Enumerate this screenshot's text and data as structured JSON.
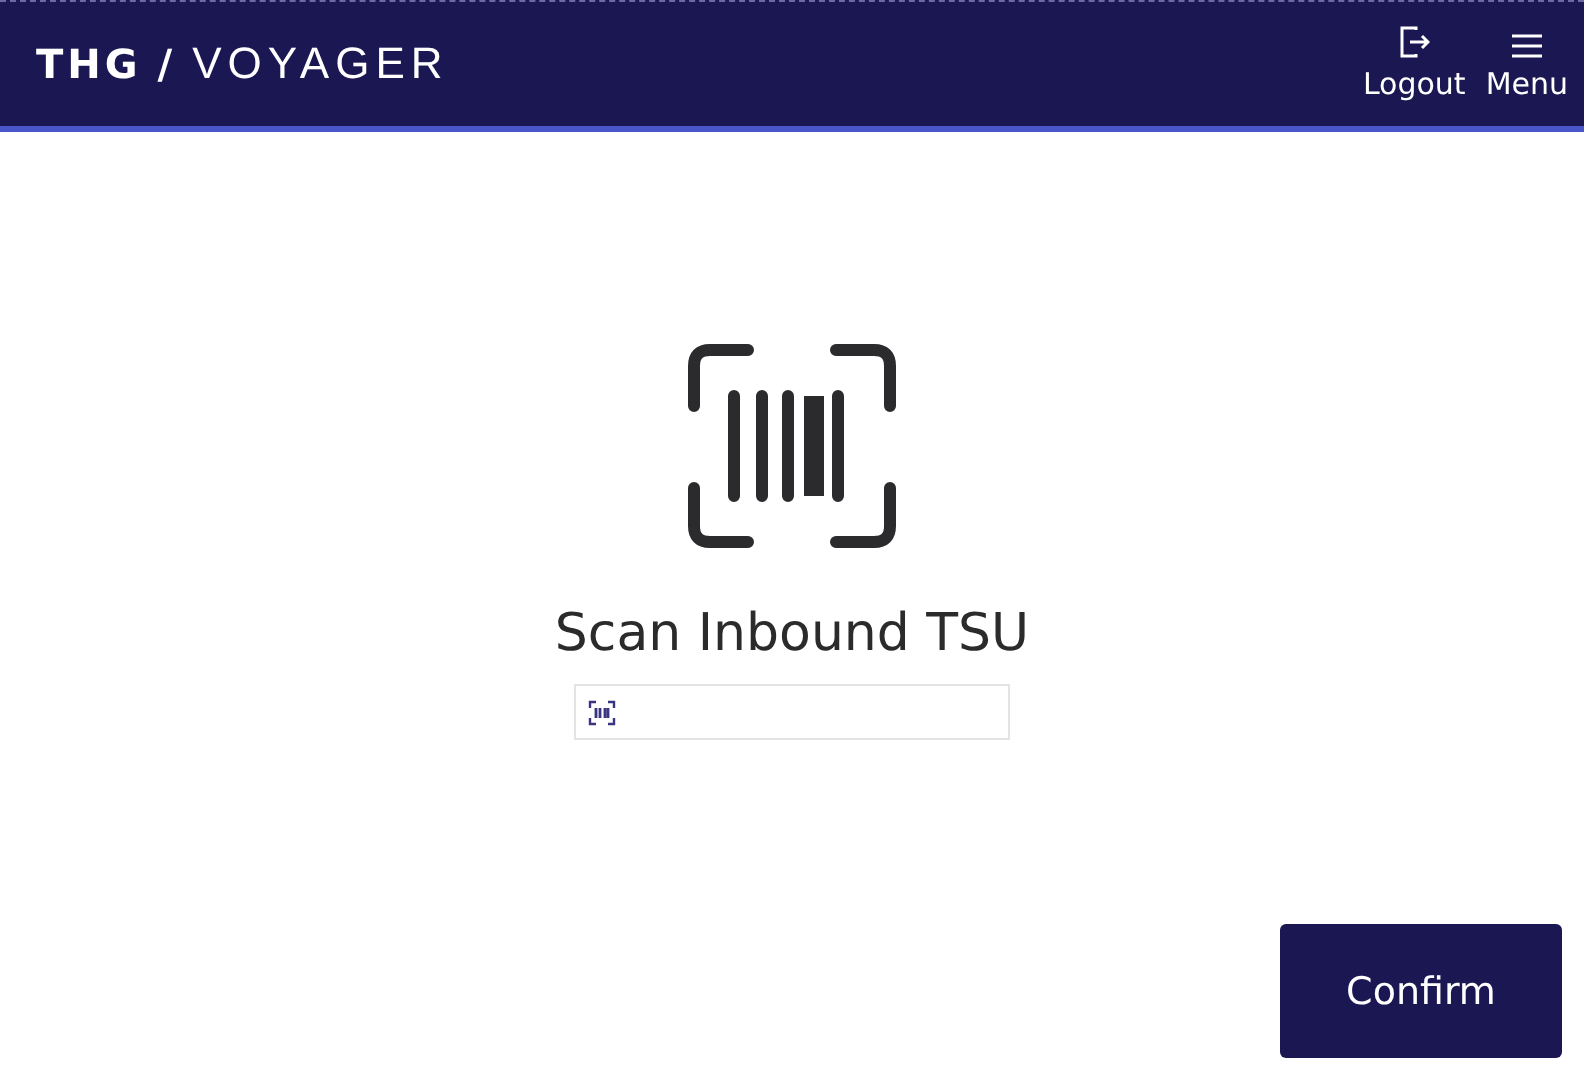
{
  "header": {
    "logo": {
      "brand": "THG",
      "separator": "/",
      "product": "VOYAGER"
    },
    "actions": [
      {
        "kind": "logout",
        "label": "Logout"
      },
      {
        "kind": "menu",
        "label": "Menu"
      }
    ]
  },
  "scan": {
    "title": "Scan Inbound TSU"
  },
  "buttons": [
    {
      "label": "Confirm"
    }
  ]
}
